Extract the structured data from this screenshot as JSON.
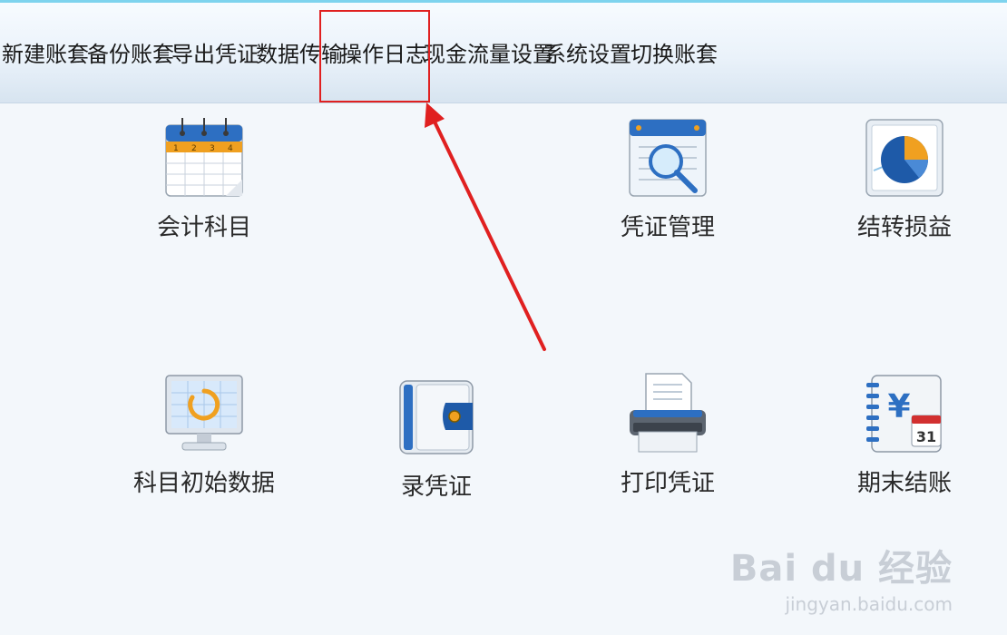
{
  "menu": {
    "items": [
      "新建账套",
      "备份账套",
      "导出凭证",
      "数据传输",
      "操作日志",
      "现金流量设置",
      "系统设置",
      "切换账套"
    ],
    "highlighted_index": 4
  },
  "tiles": {
    "accounting_subjects": "会计科目",
    "voucher_management": "凭证管理",
    "carry_forward_pl": "结转损益",
    "initial_subject_data": "科目初始数据",
    "enter_voucher": "录凭证",
    "print_voucher": "打印凭证",
    "period_end_closing": "期末结账"
  },
  "icons": {
    "calendar_numbers": [
      "1",
      "2",
      "3",
      "4"
    ],
    "period_end_day": "31",
    "period_end_currency": "¥"
  },
  "watermark": {
    "brand": "Bai du 经验",
    "url": "jingyan.baidu.com"
  },
  "colors": {
    "annotation_red": "#e02020",
    "accent_blue": "#2d6fc2",
    "accent_orange": "#f0a020"
  }
}
